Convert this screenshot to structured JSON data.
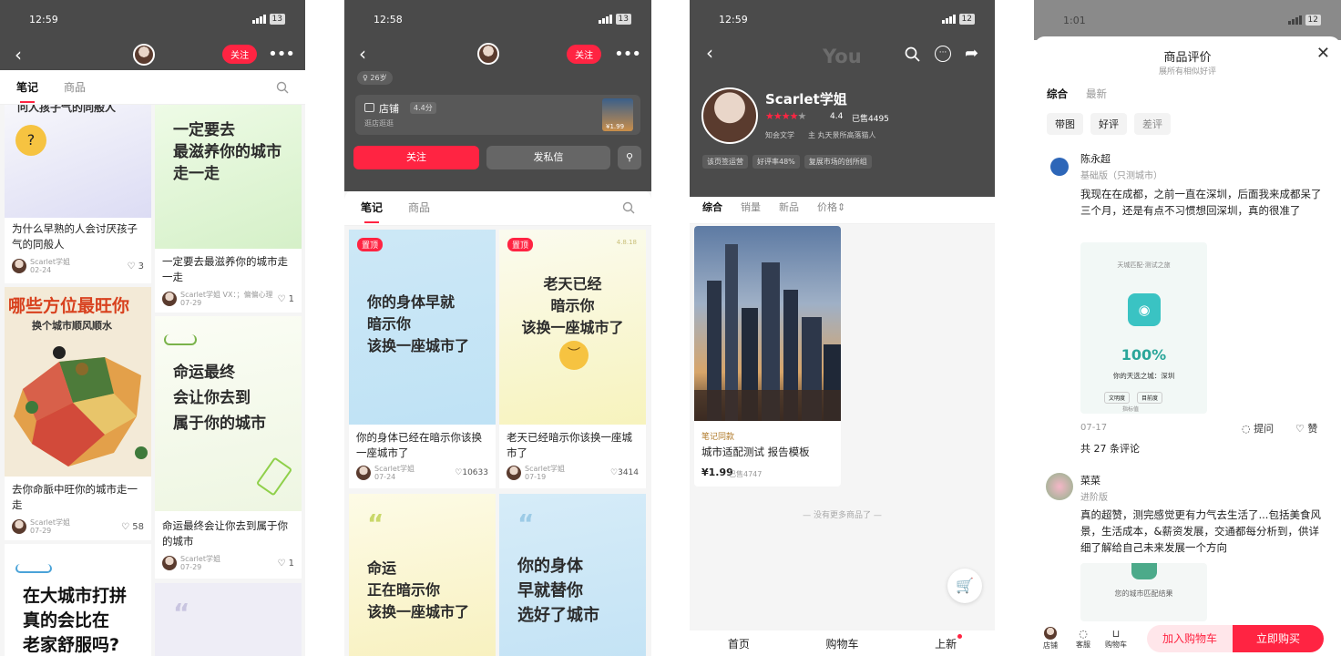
{
  "p1": {
    "time": "12:59",
    "battery": "13",
    "follow": "关注",
    "tabs": [
      "笔记",
      "商品"
    ],
    "cards": [
      {
        "cover_top": "问人孩子气的同般人",
        "title": "为什么早熟的人会讨厌孩子气的同般人",
        "author": "Scarlet学姐",
        "date": "02-24",
        "likes": "3"
      },
      {
        "cover": [
          "一定要去",
          "最滋养你的城市",
          "走一走"
        ],
        "title": "一定要去最滋养你的城市走一走",
        "author": "Scarlet学姐",
        "extra": "VX：；偏偏心理",
        "date": "07-29",
        "likes": "1"
      },
      {
        "cover_title": "哪些方位最旺你",
        "cover_sub": "换个城市顺风顺水",
        "title": "去你命脈中旺你的城市走一走",
        "author": "Scarlet学姐",
        "date": "07-29",
        "likes": "58"
      },
      {
        "cover": [
          "命运最终",
          "会让你去到",
          "属于你的城市"
        ],
        "title": "命运最终会让你去到属于你的城市",
        "author": "Scarlet学姐",
        "date": "07-29",
        "likes": "1"
      },
      {
        "cover": [
          "在大城市打拼",
          "真的会比在",
          "老家舒服吗?"
        ]
      }
    ]
  },
  "p2": {
    "time": "12:58",
    "battery": "13",
    "follow": "关注",
    "age": "26岁",
    "shop_label": "店铺",
    "shop_rating": "4.4分",
    "shop_sub": "逛店逛逛",
    "shop_price": "¥1.99",
    "btn_follow": "关注",
    "btn_msg": "发私信",
    "tabs": [
      "笔记",
      "商品"
    ],
    "pin": "置顶",
    "cards": [
      {
        "cover": [
          "你的身体早就",
          "暗示你",
          "该换一座城市了"
        ],
        "title": "你的身体已经在暗示你该换一座城市了",
        "author": "Scarlet学姐",
        "date": "07-24",
        "likes": "10633"
      },
      {
        "cover": [
          "老天已经",
          "暗示你",
          "该换一座城市了"
        ],
        "tag": "4.8.18",
        "title": "老天已经暗示你该换一座城市了",
        "author": "Scarlet学姐",
        "date": "07-19",
        "likes": "3414"
      },
      {
        "cover": [
          "命运",
          "正在暗示你",
          "该换一座城市了"
        ]
      },
      {
        "cover": [
          "你的身体",
          "早就替你",
          "选好了城市"
        ]
      }
    ]
  },
  "p3": {
    "time": "12:59",
    "battery": "12",
    "watermark": "You",
    "name": "Scarlet学姐",
    "rating": "4.4",
    "sold": "已售4495",
    "desc1": "知会文学",
    "desc2": "主 丸天景所高落猫人",
    "badges": [
      "该页签运营",
      "好评率48%",
      "复展市场的创所组"
    ],
    "tabs": [
      "综合",
      "销量",
      "新品",
      "价格"
    ],
    "product_tag": "笔记同款",
    "product_title": "城市适配测试 报告模板",
    "price": "¥1.99",
    "product_sold": "已售4747",
    "no_more": "没有更多商品了",
    "nav": [
      "首页",
      "购物车",
      "上新"
    ]
  },
  "p4": {
    "time": "1:01",
    "battery": "12",
    "title": "商品评价",
    "subtitle": "展所有相似好评",
    "tabs": [
      "综合",
      "最新"
    ],
    "filters": [
      "带图",
      "好评",
      "差评"
    ],
    "r1": {
      "name": "陈永超",
      "variant": "基础版（只测城市）",
      "text": "我现在在成都，之前一直在深圳，后面我来成都呆了三个月，还是有点不习惯想回深圳，真的很准了",
      "img_header": "天城匹配·测试之旅",
      "img_pct": "100%",
      "img_city": "你的天选之城：深圳",
      "img_tag1": "文明度",
      "img_tag2": "目前度",
      "img_foot": "指标值",
      "date": "07-17",
      "ask": "提问",
      "like": "赞"
    },
    "comments": "共 27 条评论",
    "r2": {
      "name": "菜菜",
      "variant": "进阶版",
      "text": "真的超赞，测完感觉更有力气去生活了...包括美食风景，生活成本，&薪资发展，交通都每分析到，供详细了解给自己未来发展一个方向",
      "img_text": "您的城市匹配结果"
    },
    "bottom": {
      "shop": "店铺",
      "service": "客服",
      "cart": "购物车",
      "add_cart": "加入购物车",
      "buy": "立即购买"
    }
  }
}
